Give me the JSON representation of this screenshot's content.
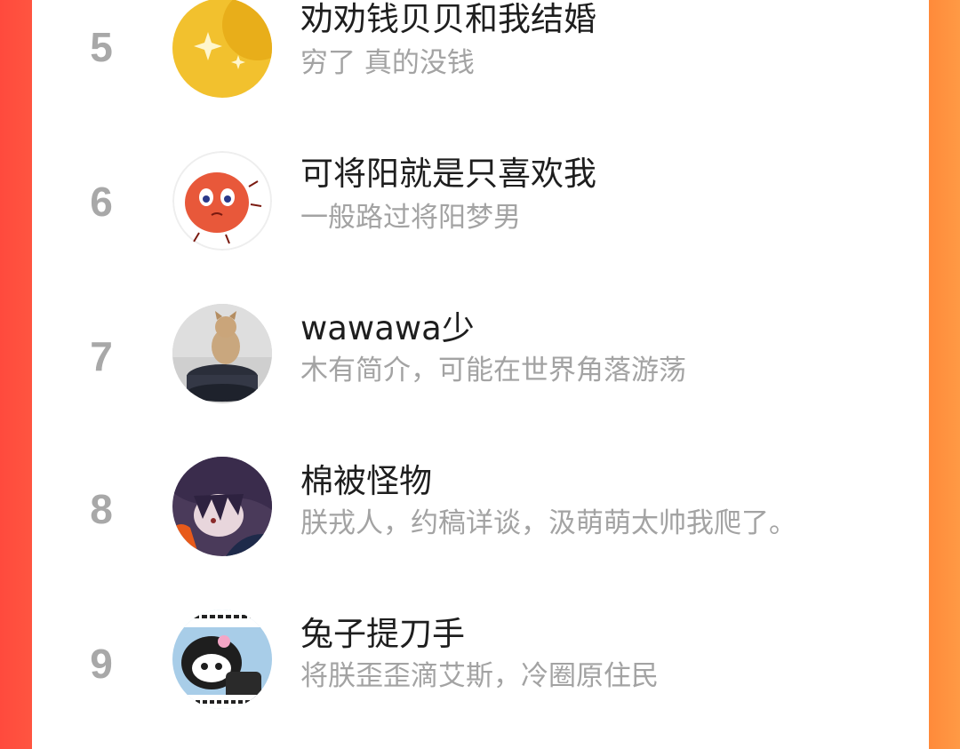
{
  "ranking": {
    "items": [
      {
        "rank": "5",
        "name": "劝劝钱贝贝和我结婚",
        "bio": "穷了 真的没钱",
        "avatar_icon": "yellow-star-avatar-icon"
      },
      {
        "rank": "6",
        "name": "可将阳就是只喜欢我",
        "bio": "一般路过将阳梦男",
        "avatar_icon": "red-blob-cartoon-avatar-icon"
      },
      {
        "rank": "7",
        "name": "wawawa少",
        "bio": "木有简介，可能在世界角落游荡",
        "avatar_icon": "cat-in-pot-avatar-icon"
      },
      {
        "rank": "8",
        "name": "棉被怪物",
        "bio": "朕戎人，约稿详谈，汲萌萌太帅我爬了。",
        "avatar_icon": "anime-character-avatar-icon"
      },
      {
        "rank": "9",
        "name": "兔子提刀手",
        "bio": "将朕歪歪滴艾斯，冷圈原住民",
        "avatar_icon": "kuromi-meme-avatar-icon"
      }
    ]
  },
  "colors": {
    "background_left": "#ff4a3d",
    "background_right": "#ff9a45",
    "panel": "#ffffff",
    "rank_text": "#a8a8a8",
    "name_text": "#1e1e1e",
    "bio_text": "#a3a3a3"
  }
}
